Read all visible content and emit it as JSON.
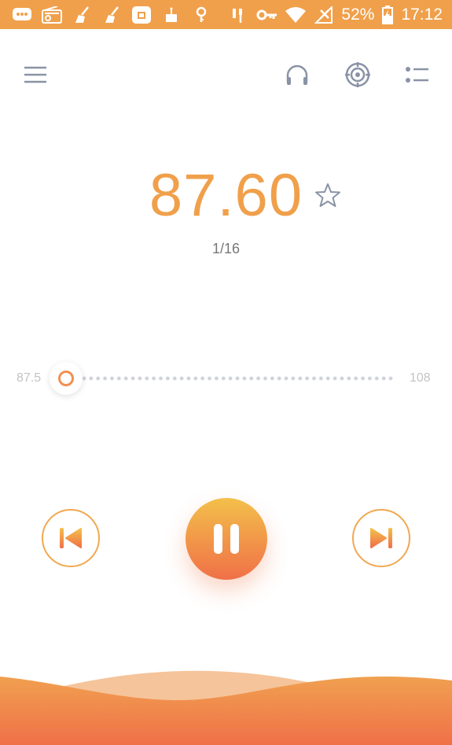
{
  "status_bar": {
    "battery_percent": "52%",
    "time": "17:12",
    "left_icons": [
      "chat-icon",
      "radio-icon",
      "broom-icon",
      "broom-icon",
      "store-icon",
      "cake-icon",
      "location-icon"
    ],
    "right_icons": [
      "headset-icon",
      "key-icon",
      "wifi-icon",
      "signal-icon",
      "battery-icon"
    ]
  },
  "toolbar": {
    "icons": [
      "menu-icon",
      "headphones-icon",
      "scan-target-icon",
      "station-list-icon"
    ]
  },
  "tuner": {
    "frequency": "87.60",
    "station_index": "1/16",
    "dial_min": "87.5",
    "dial_max": "108",
    "dial_position_fraction": 0.005
  },
  "colors": {
    "accent": "#f0a04b",
    "accent_gradient_top": "#f3c04a",
    "accent_gradient_bottom": "#f07048",
    "toolbar_icon": "#8a93a6"
  }
}
